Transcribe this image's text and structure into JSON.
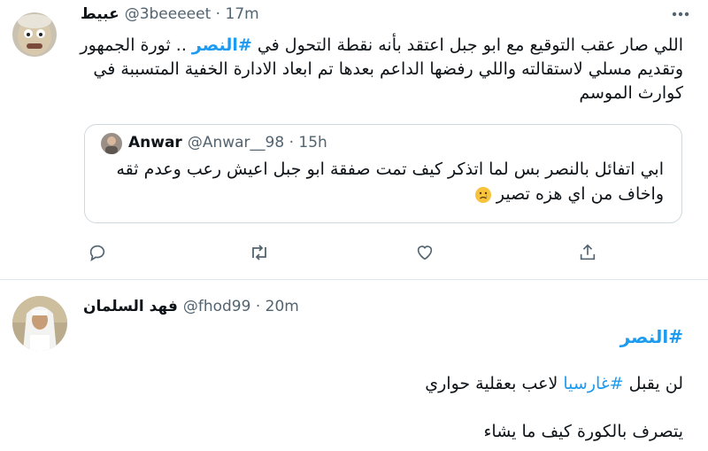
{
  "tweet1": {
    "display_name": "عبيط",
    "handle": "@3beeeeet",
    "time": "17m",
    "text_before": "اللي صار عقب التوقيع مع ابو جبل اعتقد بأنه نقطة التحول في ",
    "hashtag": "#النصر",
    "text_after": " .. ثورة الجمهور وتقديم مسلي لاستقالته واللي رفضها الداعم بعدها تم ابعاد الادارة الخفية المتسببة في كوارث الموسم",
    "quoted": {
      "display_name": "Anwar",
      "handle": "@Anwar__98",
      "time": "15h",
      "line1": "ابي اتفائل بالنصر بس لما اتذكر كيف تمت صفقة ابو جبل اعيش رعب وعدم ثقه",
      "line2": "واخاف من اي هزه تصير"
    }
  },
  "tweet2": {
    "display_name": "فهد السلمان",
    "handle": "@fhod99",
    "time": "20m",
    "hashtag": "#النصر",
    "line1_before": "لن يقبل ",
    "line1_hashtag": "#غارسيا",
    "line1_after": " لاعب بعقلية حواري",
    "line2": "يتصرف بالكورة كيف ما يشاء"
  },
  "colors": {
    "accent": "#1d9bf0",
    "text": "#0f1419",
    "muted": "#536471",
    "border": "#cfd9de"
  },
  "icons": [
    "more-icon",
    "reply-icon",
    "retweet-icon",
    "like-icon",
    "share-icon",
    "crying-emoji-icon"
  ]
}
